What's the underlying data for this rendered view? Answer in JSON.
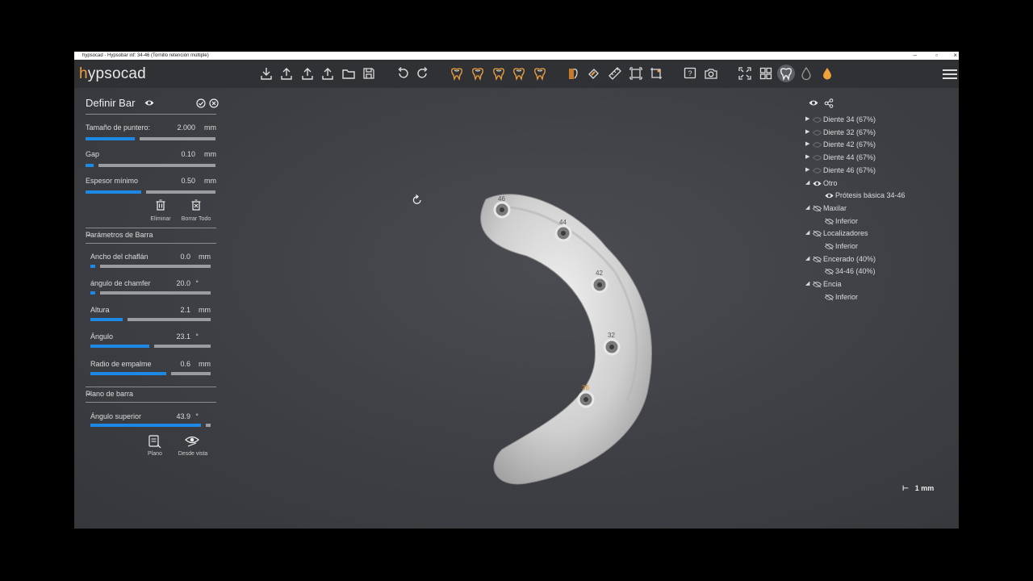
{
  "window": {
    "title": "hypsocad - Hypsobar inf: 34-46 (Tornillo retención múltiple)"
  },
  "logo": {
    "h": "h",
    "rest": "ypsocad"
  },
  "toolbar": {
    "icons": [
      "import-icon",
      "export-icon",
      "export-icon",
      "export-icon",
      "open-folder-icon",
      "save-icon",
      "undo-icon",
      "redo-icon",
      "tooth-icon",
      "tooth-icon",
      "tooth-icon",
      "tooth-icon",
      "tooth-icon",
      "tooth-view-icon",
      "brush-icon",
      "ruler-icon",
      "frame-icon",
      "crop-icon",
      "help-icon",
      "camera-icon",
      "fit-view-icon",
      "grid-icon",
      "tooth-active-icon",
      "drop-icon",
      "drop-orange-icon"
    ]
  },
  "panel": {
    "title": "Definir Bar",
    "tamano": {
      "label": "Tamaño de puntero:",
      "value": "2.000",
      "unit": "mm",
      "fraction": 0.38
    },
    "gap": {
      "label": "Gap",
      "value": "0.10",
      "unit": "mm",
      "fraction": 0.06
    },
    "espesor": {
      "label": "Espesor mínimo",
      "value": "0.50",
      "unit": "mm",
      "fraction": 0.43
    },
    "eliminar": "Eliminar",
    "borrar_todo": "Borrar Todo",
    "parametros_section": "Parámetros de Barra",
    "ancho": {
      "label": "Ancho del chaflán",
      "value": "0.0",
      "unit": "mm",
      "fraction": 0.04
    },
    "angulo_chamfer": {
      "label": "ángulo de chamfer",
      "value": "20.0",
      "unit": "°",
      "fraction": 0.04
    },
    "altura": {
      "label": "Altura",
      "value": "2.1",
      "unit": "mm",
      "fraction": 0.27
    },
    "angulo": {
      "label": "Ángulo",
      "value": "23.1",
      "unit": "°",
      "fraction": 0.49
    },
    "radio": {
      "label": "Radio de empalme",
      "value": "0.6",
      "unit": "mm",
      "fraction": 0.63
    },
    "plano_section": "Plano de barra",
    "angulo_superior": {
      "label": "Ángulo superior",
      "value": "43.9",
      "unit": "°",
      "fraction": 0.92
    },
    "plano_button": "Plano",
    "desde_vista_button": "Desde vista"
  },
  "tree": {
    "items": [
      {
        "label": "Diente 34 (67%)",
        "level": 0,
        "arrow": "▶",
        "visible": false
      },
      {
        "label": "Diente 32 (67%)",
        "level": 0,
        "arrow": "▶",
        "visible": false
      },
      {
        "label": "Diente 42 (67%)",
        "level": 0,
        "arrow": "▶",
        "visible": false
      },
      {
        "label": "Diente 44 (67%)",
        "level": 0,
        "arrow": "▶",
        "visible": false
      },
      {
        "label": "Diente 46 (67%)",
        "level": 0,
        "arrow": "▶",
        "visible": false
      },
      {
        "label": "Otro",
        "level": 0,
        "arrow": "◢",
        "visible": true
      },
      {
        "label": "Prótesis básica 34-46",
        "level": 1,
        "arrow": "",
        "visible": true
      },
      {
        "label": "Maxilar",
        "level": 0,
        "arrow": "◢",
        "visible": false
      },
      {
        "label": "Inferior",
        "level": 1,
        "arrow": "",
        "visible": false
      },
      {
        "label": "Localizadores",
        "level": 0,
        "arrow": "◢",
        "visible": false
      },
      {
        "label": "Inferior",
        "level": 1,
        "arrow": "",
        "visible": false
      },
      {
        "label": "Encerado (40%)",
        "level": 0,
        "arrow": "◢",
        "visible": false
      },
      {
        "label": "34-46 (40%)",
        "level": 1,
        "arrow": "",
        "visible": false
      },
      {
        "label": "Encia",
        "level": 0,
        "arrow": "◢",
        "visible": false
      },
      {
        "label": "Inferior",
        "level": 1,
        "arrow": "",
        "visible": false
      }
    ]
  },
  "model": {
    "implants": [
      "46",
      "44",
      "42",
      "32",
      "36"
    ]
  },
  "scale": {
    "label": "1 mm"
  },
  "colors": {
    "accent": "#1e88e5",
    "brand": "#f0a13a"
  }
}
